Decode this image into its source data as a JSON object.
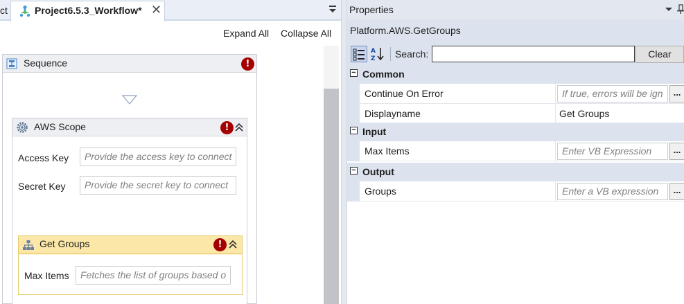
{
  "designer": {
    "tab_stub": "ct",
    "tab_title": "Project6.5.3_Workflow*",
    "tab_close": "✕",
    "expand_all": "Expand All",
    "collapse_all": "Collapse All",
    "sequence": {
      "title": "Sequence",
      "error": "!"
    },
    "aws_scope": {
      "title": "AWS Scope",
      "error": "!",
      "fields": [
        {
          "label": "Access Key",
          "placeholder": "Provide the access key to connect"
        },
        {
          "label": "Secret Key",
          "placeholder": "Provide the secret key to connect"
        }
      ]
    },
    "get_groups": {
      "title": "Get Groups",
      "error": "!",
      "field": {
        "label": "Max Items",
        "placeholder": "Fetches the list of groups based o"
      }
    }
  },
  "properties": {
    "title": "Properties",
    "subtitle": "Platform.AWS.GetGroups",
    "search_label": "Search:",
    "search_value": "",
    "clear_label": "Clear",
    "categories": [
      {
        "label": "Common",
        "toggle": "−",
        "rows": [
          {
            "name": "Continue On Error",
            "placeholder": "If true, errors will be ign",
            "ellipsis": "..."
          },
          {
            "name": "Displayname",
            "value": "Get Groups"
          }
        ]
      },
      {
        "label": "Input",
        "toggle": "−",
        "rows": [
          {
            "name": "Max Items",
            "placeholder": "Enter VB Expression",
            "ellipsis": "..."
          }
        ]
      },
      {
        "label": "Output",
        "toggle": "−",
        "rows": [
          {
            "name": "Groups",
            "placeholder": "Enter a VB expression",
            "ellipsis": "..."
          }
        ]
      }
    ]
  },
  "icons": {
    "tab": "workflow-icon",
    "sequence": "sequence-icon",
    "aws_scope": "gear-icon",
    "get_groups": "hierarchy-icon",
    "error": "error-icon",
    "collapse": "double-chevron-up-icon",
    "categorized": "categorized-view-icon",
    "alphabetical": "sort-alphabetical-icon"
  },
  "colors": {
    "error": "#a40000",
    "selected_activity_header": "#fbe7a7",
    "selected_activity_body": "#fdf4d7",
    "panel_header": "#dde3ee"
  }
}
